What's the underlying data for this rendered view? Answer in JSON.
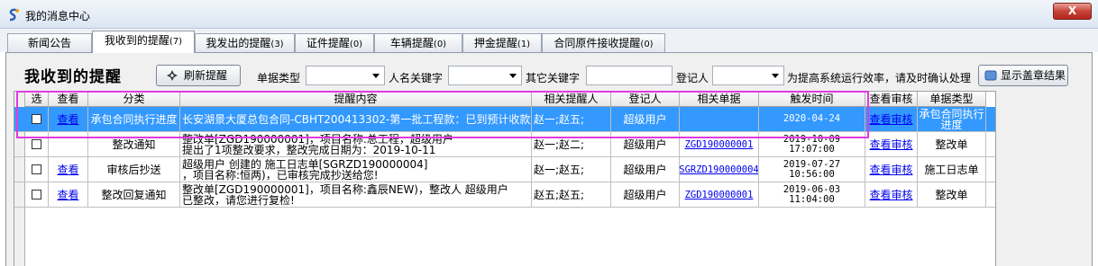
{
  "window": {
    "title": "我的消息中心",
    "close_label": "X"
  },
  "tabs": [
    {
      "label": "新闻公告",
      "badge": ""
    },
    {
      "label": "我收到的提醒",
      "badge": "(7)"
    },
    {
      "label": "我发出的提醒",
      "badge": "(3)"
    },
    {
      "label": "证件提醒",
      "badge": "(0)"
    },
    {
      "label": "车辆提醒",
      "badge": "(0)"
    },
    {
      "label": "押金提醒",
      "badge": "(1)"
    },
    {
      "label": "合同原件接收提醒",
      "badge": "(0)"
    }
  ],
  "toolbar": {
    "heading": "我收到的提醒",
    "refresh_label": "刷新提醒",
    "type_label": "单据类型",
    "type_value": "",
    "name_label": "人名关键字",
    "name_value": "",
    "other_label": "其它关键字",
    "other_value": "",
    "registrar_label": "登记人",
    "registrar_value": "",
    "hint": "为提高系统运行效率，请及时确认处理",
    "show_seal_label": "显示盖章结果"
  },
  "grid": {
    "headers": [
      "选",
      "查看",
      "分类",
      "提醒内容",
      "相关提醒人",
      "登记人",
      "相关单据",
      "触发时间",
      "查看审核",
      "单据类型"
    ],
    "rows": [
      {
        "view": "查看",
        "category": "承包合同执行进度",
        "content": "长安湖景大厦总包合同-CBHT200413302-第一批工程款：已到预计收款时间",
        "people": "赵一;赵五;",
        "registrar": "超级用户",
        "doc": "",
        "time": "2020-04-24",
        "audit": "查看审核",
        "doctype": "承包合同执行进度"
      },
      {
        "view": "",
        "category": "整改通知",
        "content": "整改单[ZGD190000001]，项目名称:总工程，超级用户\n提出了1项整改要求，整改完成日期为：2019-10-11",
        "people": "赵一;赵二;",
        "registrar": "超级用户",
        "doc": "ZGD190000001",
        "time": "2019-10-09\n17:07:00",
        "audit": "查看审核",
        "doctype": "整改单"
      },
      {
        "view": "查看",
        "category": "审核后抄送",
        "content": "超级用户 创建的 施工日志单[SGRZD190000004]\n，项目名称:恒两)，已审核完成抄送给您!",
        "people": "赵一;赵五;",
        "registrar": "超级用户",
        "doc": "SGRZD190000004",
        "time": "2019-07-27\n10:56:00",
        "audit": "查看审核",
        "doctype": "施工日志单"
      },
      {
        "view": "查看",
        "category": "整改回复通知",
        "content": "整改单[ZGD190000001]，项目名称:鑫辰NEW)，整改人 超级用户\n已整改，请您进行复检!",
        "people": "赵五;赵五;",
        "registrar": "超级用户",
        "doc": "ZGD190000001",
        "time": "2019-06-03\n11:04:00",
        "audit": "查看审核",
        "doctype": "整改单"
      }
    ]
  },
  "colors": {
    "selected_row": "#3399ff",
    "highlight": "#e03be0",
    "link": "#0000ee"
  }
}
